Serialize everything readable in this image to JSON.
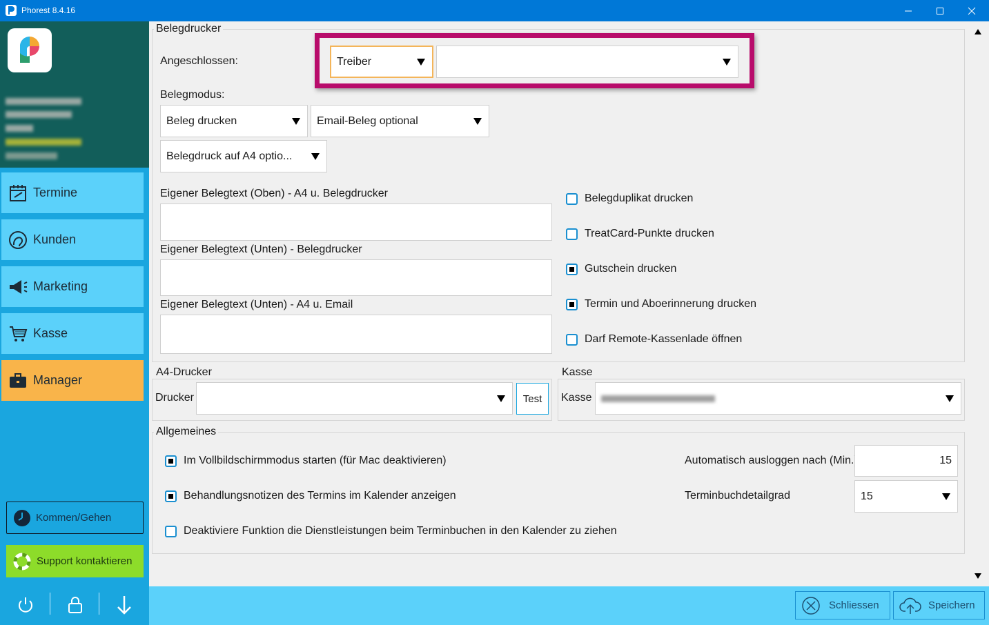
{
  "window": {
    "title": "Phorest 8.4.16"
  },
  "sidebar": {
    "nav": [
      {
        "label": "Termine",
        "icon": "calendar-icon"
      },
      {
        "label": "Kunden",
        "icon": "profile-icon"
      },
      {
        "label": "Marketing",
        "icon": "megaphone-icon"
      },
      {
        "label": "Kasse",
        "icon": "cart-icon"
      },
      {
        "label": "Manager",
        "icon": "briefcase-icon"
      }
    ],
    "kommen_label": "Kommen/Gehen",
    "support_label": "Support kontaktieren"
  },
  "belegdrucker": {
    "title": "Belegdrucker",
    "angeschlossen_label": "Angeschlossen:",
    "driver_value": "Treiber",
    "printer_value": "",
    "belegmodus_label": "Belegmodus:",
    "modus1": "Beleg drucken",
    "modus2": "Email-Beleg optional",
    "modus3": "Belegdruck auf A4 optio...",
    "text_oben_label": "Eigener Belegtext (Oben) - A4 u. Belegdrucker",
    "text_unten_label": "Eigener Belegtext (Unten) - Belegdrucker",
    "text_unten_email_label": "Eigener Belegtext (Unten) - A4 u. Email",
    "checks": [
      {
        "label": "Belegduplikat drucken",
        "checked": false
      },
      {
        "label": "TreatCard-Punkte drucken",
        "checked": false
      },
      {
        "label": "Gutschein drucken",
        "checked": true
      },
      {
        "label": "Termin und Aboerinnerung drucken",
        "checked": true
      },
      {
        "label": "Darf Remote-Kassenlade öffnen",
        "checked": false
      }
    ]
  },
  "a4": {
    "title": "A4-Drucker",
    "drucker_label": "Drucker",
    "drucker_value": "",
    "test_label": "Test"
  },
  "kasse": {
    "title": "Kasse",
    "kasse_label": "Kasse"
  },
  "allgemeines": {
    "title": "Allgemeines",
    "checks": [
      {
        "label": "Im Vollbildschirmmodus starten (für Mac deaktivieren)",
        "checked": true
      },
      {
        "label": "Behandlungsnotizen des Termins im Kalender anzeigen",
        "checked": true
      },
      {
        "label": "Deaktiviere Funktion die Dienstleistungen beim Terminbuchen in den Kalender zu ziehen",
        "checked": false
      }
    ],
    "logout_label": "Automatisch ausloggen nach (Min.)",
    "logout_value": "15",
    "detail_label": "Terminbuchdetailgrad",
    "detail_value": "15"
  },
  "footer": {
    "close_label": "Schliessen",
    "save_label": "Speichern"
  }
}
